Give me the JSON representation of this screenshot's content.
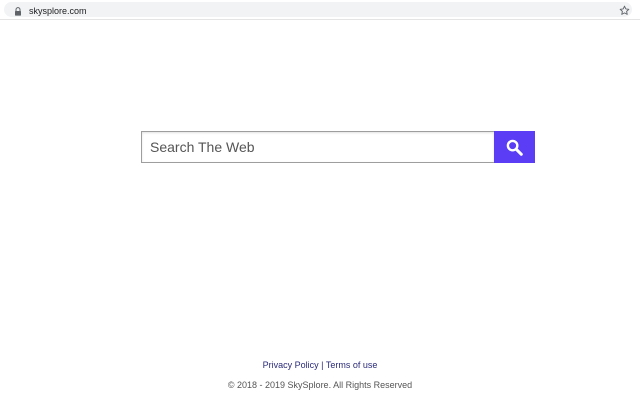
{
  "browser": {
    "url": "skysplore.com",
    "lock_icon": "lock-icon",
    "bookmark_icon": "star-icon"
  },
  "search": {
    "placeholder": "Search The Web",
    "value": "",
    "button_icon": "magnifier-icon",
    "button_color": "#5a3df5"
  },
  "footer": {
    "privacy_label": "Privacy Policy",
    "separator": "|",
    "terms_label": "Terms of use",
    "copyright": "© 2018 - 2019 SkySplore. All Rights Reserved"
  }
}
